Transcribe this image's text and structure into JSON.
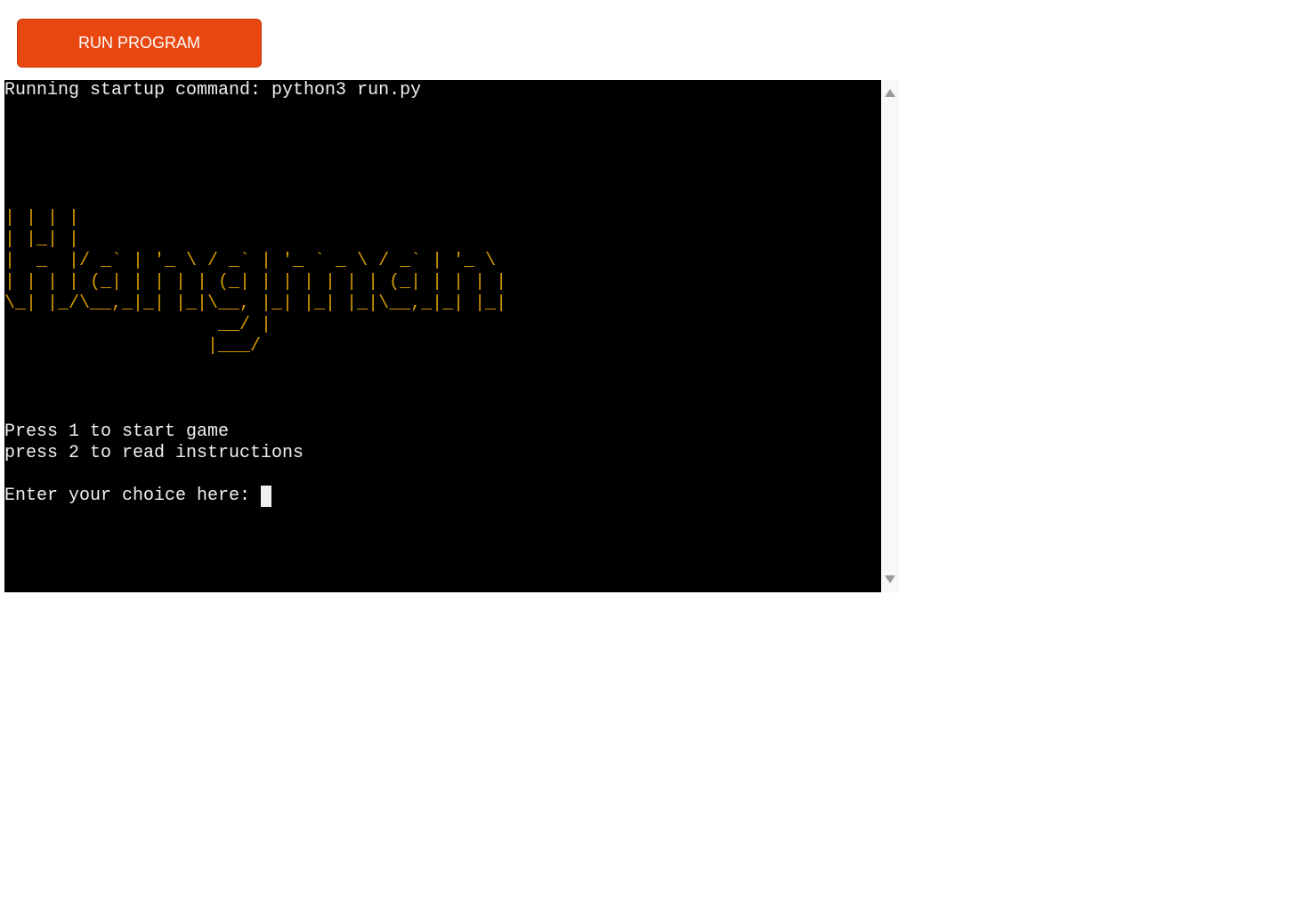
{
  "toolbar": {
    "run_label": "RUN PROGRAM"
  },
  "terminal": {
    "startup": "Running startup command: python3 run.py",
    "ascii_art": [
      "| | | |",
      "| |_| |",
      "|  _  |/ _` | '_ \\ / _` | '_ ` _ \\ / _` | '_ \\",
      "| | | | (_| | | | | (_| | | | | | | (_| | | | |",
      "\\_| |_/\\__,_|_| |_|\\__, |_| |_| |_|\\__,_|_| |_|",
      "                    __/ |",
      "                   |___/"
    ],
    "menu_line_1": "Press 1 to start game",
    "menu_line_2": "press 2 to read instructions",
    "prompt": "Enter your choice here: "
  },
  "colors": {
    "button": "#e8470f",
    "terminal_bg": "#000000",
    "terminal_text": "#f0f0f0",
    "ascii_art": "#d79b00"
  }
}
